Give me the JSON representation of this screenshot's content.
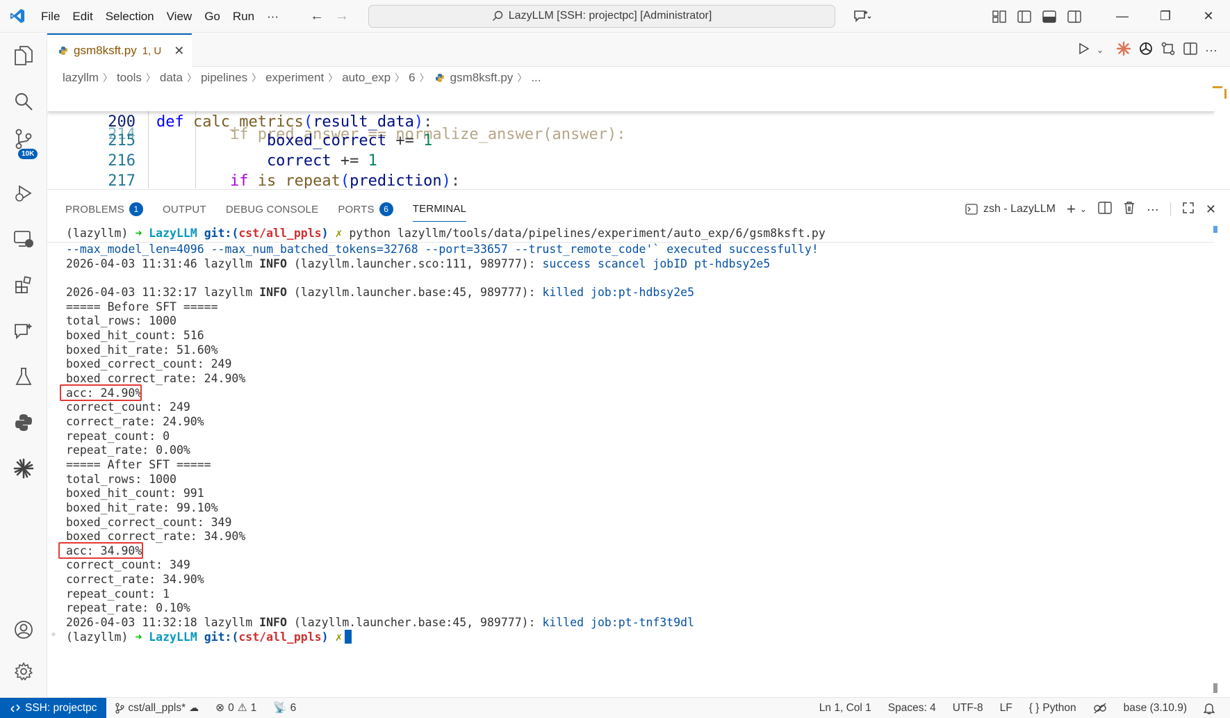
{
  "titlebar": {
    "menu": [
      "File",
      "Edit",
      "Selection",
      "View",
      "Go",
      "Run",
      "···"
    ],
    "command_center": "LazyLLM [SSH: projectpc] [Administrator]"
  },
  "activity": {
    "source_control_badge": "10K"
  },
  "tab": {
    "filename": "gsm8ksft.py",
    "status": "1, U"
  },
  "breadcrumb": [
    "lazyllm",
    "tools",
    "data",
    "pipelines",
    "experiment",
    "auto_exp",
    "6",
    "gsm8ksft.py",
    "..."
  ],
  "code": {
    "sticky": {
      "line": "200",
      "def": "def",
      "name": "calc_metrics",
      "param": "result_data"
    },
    "partial": {
      "line": "214",
      "text": "if pred_answer == normalize_answer(answer):"
    },
    "lines": [
      {
        "line": "215",
        "var": "boxed_correct",
        "op": " += ",
        "num": "1"
      },
      {
        "line": "216",
        "var": "correct",
        "op": " += ",
        "num": "1"
      },
      {
        "line": "217",
        "kw": "if",
        "fn": "is_repeat",
        "arg": "prediction"
      }
    ]
  },
  "panel": {
    "tabs": [
      {
        "label": "PROBLEMS",
        "badge": "1"
      },
      {
        "label": "OUTPUT"
      },
      {
        "label": "DEBUG CONSOLE"
      },
      {
        "label": "PORTS",
        "badge": "6"
      },
      {
        "label": "TERMINAL"
      }
    ],
    "terminal_name": "zsh - LazyLLM"
  },
  "terminal": {
    "prompt_env": "(lazyllm)",
    "prompt_arrow": "➜",
    "prompt_dir": "LazyLLM",
    "prompt_git": "git:(",
    "prompt_branch": "cst/all_ppls",
    "prompt_git_close": ")",
    "prompt_dirty": "✗",
    "command": "python lazyllm/tools/data/pipelines/experiment/auto_exp/6/gsm8ksft.py",
    "line_cmd_tail": "--max_model_len=4096 --max_num_batched_tokens=32768 --port=33657 --trust_remote_code'` executed successfully!",
    "log1_prefix": "2026-04-03 11:31:46 lazyllm ",
    "log1_level": "INFO",
    "log1_src": " (lazyllm.launcher.sco:111, 989777): ",
    "log1_msg": "success scancel jobID pt-hdbsy2e5",
    "log2_prefix": "2026-04-03 11:32:17 lazyllm ",
    "log2_level": "INFO",
    "log2_src": " (lazyllm.launcher.base:45, 989777): ",
    "log2_msg": "killed job:pt-hdbsy2e5",
    "before": [
      "===== Before SFT =====",
      "total_rows: 1000",
      "boxed_hit_count: 516",
      "boxed_hit_rate: 51.60%",
      "boxed_correct_count: 249",
      "boxed_correct_rate: 24.90%",
      "acc: 24.90%",
      "correct_count: 249",
      "correct_rate: 24.90%",
      "repeat_count: 0",
      "repeat_rate: 0.00%"
    ],
    "after": [
      "===== After SFT =====",
      "total_rows: 1000",
      "boxed_hit_count: 991",
      "boxed_hit_rate: 99.10%",
      "boxed_correct_count: 349",
      "boxed_correct_rate: 34.90%",
      "acc: 34.90%",
      "correct_count: 349",
      "correct_rate: 34.90%",
      "repeat_count: 1",
      "repeat_rate: 0.10%"
    ],
    "log3_prefix": "2026-04-03 11:32:18 lazyllm ",
    "log3_level": "INFO",
    "log3_src": " (lazyllm.launcher.base:45, 989777): ",
    "log3_msg": "killed job:pt-tnf3t9dl"
  },
  "statusbar": {
    "remote": "SSH: projectpc",
    "branch": "cst/all_ppls*",
    "errors": "0",
    "warnings": "1",
    "ports": "6",
    "position": "Ln 1, Col 1",
    "spaces": "Spaces: 4",
    "encoding": "UTF-8",
    "eol": "LF",
    "language": "Python",
    "interpreter": "base (3.10.9)"
  },
  "colors": {
    "accent": "#005fb8",
    "highlight_box": "#e53935"
  }
}
